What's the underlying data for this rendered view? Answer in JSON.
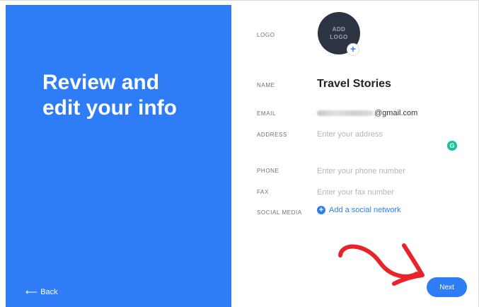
{
  "left_panel": {
    "headline_line1": "Review and",
    "headline_line2": "edit your info",
    "back_label": "Back",
    "back_arrow": "⟵",
    "color": "#2f7df6"
  },
  "form": {
    "logo": {
      "label": "LOGO",
      "add_line1": "ADD",
      "add_line2": "LOGO",
      "plus": "+"
    },
    "name": {
      "label": "NAME",
      "value": "Travel Stories"
    },
    "email": {
      "label": "EMAIL",
      "value_suffix": "@gmail.com"
    },
    "address": {
      "label": "ADDRESS",
      "placeholder": "Enter your address"
    },
    "phone": {
      "label": "PHONE",
      "placeholder": "Enter your phone number"
    },
    "fax": {
      "label": "FAX",
      "placeholder": "Enter your fax number"
    },
    "social_media": {
      "label": "SOCIAL MEDIA",
      "link_label": "Add a social network",
      "plus": "+"
    }
  },
  "grammarly": {
    "glyph": "G",
    "color": "#15c39a"
  },
  "actions": {
    "next_label": "Next"
  },
  "annotation": {
    "arrow_color": "#e8232a"
  }
}
